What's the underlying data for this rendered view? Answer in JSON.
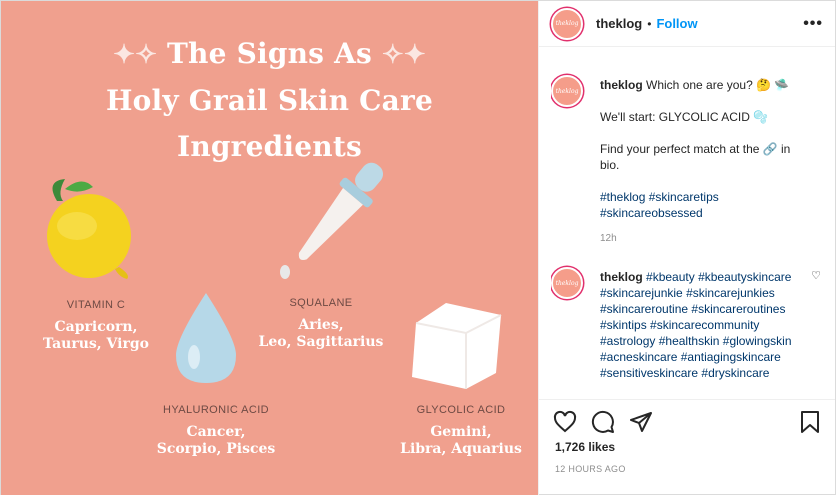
{
  "media": {
    "title_lines": [
      "The Signs As",
      "Holy Grail Skin Care",
      "Ingredients"
    ],
    "sparkle": "✦✧",
    "signs": [
      {
        "ingredient": "VITAMIN C",
        "zodiac_1": "Capricorn,",
        "zodiac_2": "Taurus, Virgo"
      },
      {
        "ingredient": "SQUALANE",
        "zodiac_1": "Aries,",
        "zodiac_2": "Leo, Sagittarius"
      },
      {
        "ingredient": "HYALURONIC ACID",
        "zodiac_1": "Cancer,",
        "zodiac_2": "Scorpio, Pisces"
      },
      {
        "ingredient": "GLYCOLIC ACID",
        "zodiac_1": "Gemini,",
        "zodiac_2": "Libra, Aquarius"
      }
    ]
  },
  "header": {
    "avatar_text": "theklog",
    "username": "theklog",
    "separator": "•",
    "follow_label": "Follow",
    "more": "•••"
  },
  "caption": {
    "username": "theklog",
    "line1": "Which one are you? 🤔 🛸",
    "line2": "We'll start: GLYCOLIC ACID 🫧",
    "line3": "Find your perfect match at the 🔗 in bio.",
    "tags": [
      "#theklog",
      "#skincaretips",
      "#skincareobsessed"
    ],
    "time": "12h"
  },
  "comment": {
    "username": "theklog",
    "tags": [
      "#kbeauty",
      "#kbeautyskincare",
      "#skincarejunkie",
      "#skincarejunkies",
      "#skincareroutine",
      "#skincareroutines",
      "#skintips",
      "#skincarecommunity",
      "#astrology",
      "#healthskin",
      "#glowingskin",
      "#acneskincare",
      "#antiagingskincare",
      "#sensitiveskincare",
      "#dryskincare"
    ],
    "heart": "♡"
  },
  "actions": {
    "likes": "1,726 likes",
    "posted": "12 HOURS AGO"
  },
  "colors": {
    "background": "#f0a08e",
    "link": "#0095f6",
    "hashtag": "#00376b"
  }
}
